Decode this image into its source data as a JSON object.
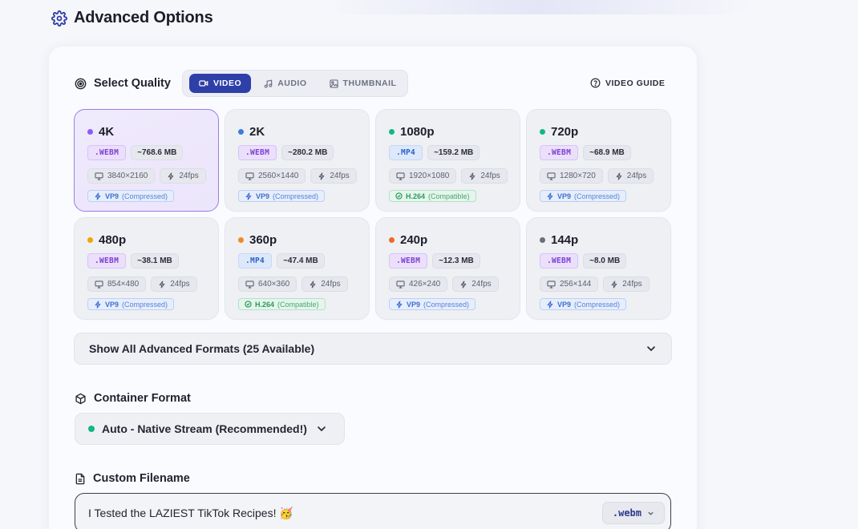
{
  "page": {
    "title": "Advanced Options"
  },
  "quality": {
    "label": "Select Quality",
    "tabs": [
      {
        "label": "VIDEO",
        "icon": "video-icon",
        "active": true
      },
      {
        "label": "AUDIO",
        "icon": "music-note-icon",
        "active": false
      },
      {
        "label": "THUMBNAIL",
        "icon": "image-icon",
        "active": false
      }
    ],
    "guide_label": "VIDEO GUIDE",
    "options": [
      {
        "name": "4K",
        "dot": "#8b5cf6",
        "format": ".WEBM",
        "fmt": "webm",
        "size": "~768.6 MB",
        "resolution": "3840×2160",
        "fps": "24fps",
        "codec": "VP9",
        "codec_note": "(Compressed)",
        "codec_kind": "vp9",
        "selected": true
      },
      {
        "name": "2K",
        "dot": "#3b7ddd",
        "format": ".WEBM",
        "fmt": "webm",
        "size": "~280.2 MB",
        "resolution": "2560×1440",
        "fps": "24fps",
        "codec": "VP9",
        "codec_note": "(Compressed)",
        "codec_kind": "vp9",
        "selected": false
      },
      {
        "name": "1080p",
        "dot": "#10b981",
        "format": ".MP4",
        "fmt": "mp4",
        "size": "~159.2 MB",
        "resolution": "1920×1080",
        "fps": "24fps",
        "codec": "H.264",
        "codec_note": "(Compatible)",
        "codec_kind": "h264",
        "selected": false
      },
      {
        "name": "720p",
        "dot": "#10b981",
        "format": ".WEBM",
        "fmt": "webm",
        "size": "~68.9 MB",
        "resolution": "1280×720",
        "fps": "24fps",
        "codec": "VP9",
        "codec_note": "(Compressed)",
        "codec_kind": "vp9",
        "selected": false
      },
      {
        "name": "480p",
        "dot": "#f0a500",
        "format": ".WEBM",
        "fmt": "webm",
        "size": "~38.1 MB",
        "resolution": "854×480",
        "fps": "24fps",
        "codec": "VP9",
        "codec_note": "(Compressed)",
        "codec_kind": "vp9",
        "selected": false
      },
      {
        "name": "360p",
        "dot": "#f08a24",
        "format": ".MP4",
        "fmt": "mp4",
        "size": "~47.4 MB",
        "resolution": "640×360",
        "fps": "24fps",
        "codec": "H.264",
        "codec_note": "(Compatible)",
        "codec_kind": "h264",
        "selected": false
      },
      {
        "name": "240p",
        "dot": "#f06a24",
        "format": ".WEBM",
        "fmt": "webm",
        "size": "~12.3 MB",
        "resolution": "426×240",
        "fps": "24fps",
        "codec": "VP9",
        "codec_note": "(Compressed)",
        "codec_kind": "vp9",
        "selected": false
      },
      {
        "name": "144p",
        "dot": "#6b6f7a",
        "format": ".WEBM",
        "fmt": "webm",
        "size": "~8.0 MB",
        "resolution": "256×144",
        "fps": "24fps",
        "codec": "VP9",
        "codec_note": "(Compressed)",
        "codec_kind": "vp9",
        "selected": false
      }
    ]
  },
  "advanced_formats": {
    "label": "Show All Advanced Formats (25 Available)"
  },
  "container": {
    "label": "Container Format",
    "selected": "Auto - Native Stream (Recommended!)",
    "dot_color": "#10b981"
  },
  "filename": {
    "label": "Custom Filename",
    "value": "I Tested the LAZIEST TikTok Recipes! 🥳",
    "extension": ".webm"
  },
  "colors": {
    "accent": "#2f3fa8",
    "selected_border": "#9a7fe6"
  }
}
